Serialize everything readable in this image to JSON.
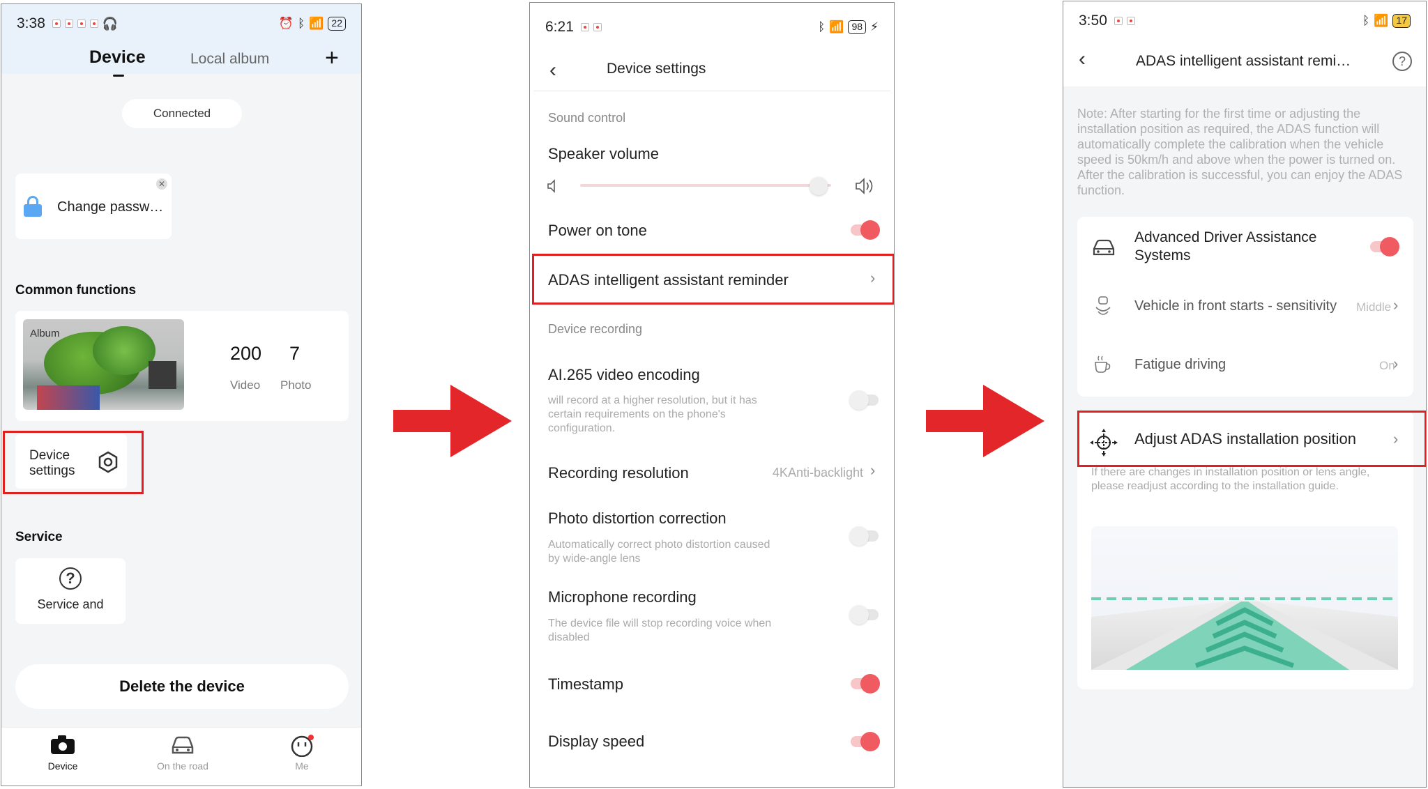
{
  "screen1": {
    "status": {
      "time": "3:38",
      "battery": "22"
    },
    "tabs": {
      "device": "Device",
      "album": "Local album",
      "add": "+"
    },
    "connected": "Connected",
    "password_card": "Change passw…",
    "common_functions": "Common functions",
    "album": {
      "label": "Album",
      "video_count": "200",
      "video_label": "Video",
      "photo_count": "7",
      "photo_label": "Photo"
    },
    "device_settings": "Device settings",
    "service_title": "Service",
    "service_item": "Service and",
    "delete": "Delete the device",
    "nav": {
      "device": "Device",
      "road": "On the road",
      "me": "Me"
    }
  },
  "screen2": {
    "status": {
      "time": "6:21",
      "battery": "98"
    },
    "title": "Device settings",
    "sound_control": "Sound control",
    "speaker_volume": "Speaker volume",
    "power_on_tone": "Power on tone",
    "adas": "ADAS intelligent assistant reminder",
    "device_recording": "Device recording",
    "ai265": "AI.265 video encoding",
    "ai265_desc": "will record at a higher resolution, but it has certain requirements on the phone's configuration.",
    "recording_resolution": "Recording resolution",
    "resolution_value": "4KAnti-backlight",
    "photo_distortion": "Photo distortion correction",
    "photo_distortion_desc": "Automatically correct photo distortion caused by wide-angle lens",
    "microphone": "Microphone recording",
    "microphone_desc": "The device file will stop recording voice when disabled",
    "timestamp": "Timestamp",
    "display_speed": "Display speed",
    "volume_level": 0.95
  },
  "screen3": {
    "status": {
      "time": "3:50",
      "battery": "17"
    },
    "title": "ADAS intelligent assistant remi…",
    "note": "Note: After starting for the first time or adjusting the installation position as required, the ADAS function will automatically complete the calibration when the vehicle speed is 50km/h and above when the power is turned on. After the calibration is successful, you can enjoy the ADAS function.",
    "adas_systems": "Advanced Driver Assistance Systems",
    "vehicle_front": "Vehicle in front starts - sensitivity",
    "vehicle_front_value": "Middle",
    "fatigue": "Fatigue driving",
    "fatigue_value": "On",
    "adjust": "Adjust ADAS installation position",
    "adjust_desc": "If there are changes in installation position or lens angle, please readjust according to the installation guide."
  },
  "colors": {
    "highlight": "#e02020",
    "arrow": "#e3262a",
    "toggle_on": "#ef5b61",
    "lane": "#6ccfb0"
  }
}
